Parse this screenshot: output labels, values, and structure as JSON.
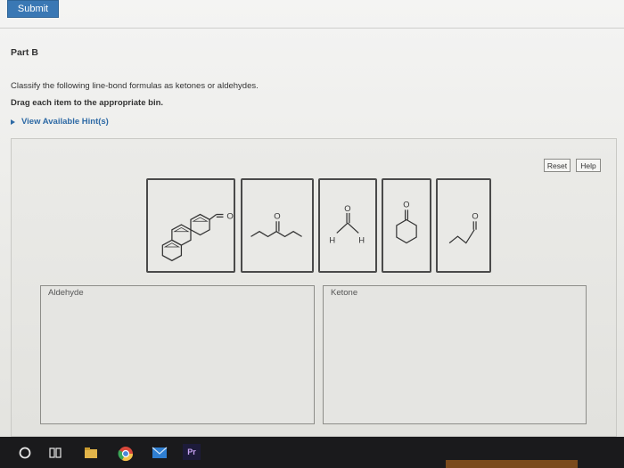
{
  "toolbar": {
    "submit_label": "Submit"
  },
  "part": {
    "title": "Part B",
    "instruction": "Classify the following line-bond formulas as ketones or aldehydes.",
    "drag_instruction": "Drag each item to the appropriate bin.",
    "hint_link": "View Available Hint(s)"
  },
  "controls": {
    "reset_label": "Reset",
    "help_label": "Help"
  },
  "molecules": {
    "m1": {
      "o": "O"
    },
    "m2": {
      "o": "O"
    },
    "m3": {
      "o": "O",
      "h_left": "H",
      "h_right": "H"
    },
    "m4": {
      "o": "O"
    },
    "m5": {
      "o": "O"
    }
  },
  "bins": {
    "aldehyde": "Aldehyde",
    "ketone": "Ketone"
  },
  "taskbar": {
    "pr_label": "Pr"
  },
  "colors": {
    "accent": "#3a78b4",
    "link": "#2e6aa5",
    "taskbar": "#1a1a1c"
  }
}
